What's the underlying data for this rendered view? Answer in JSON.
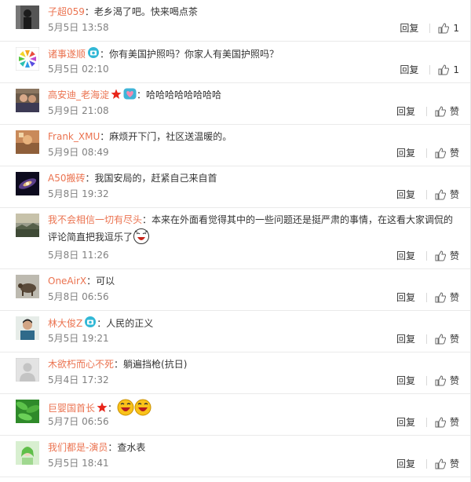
{
  "comments": [
    {
      "user": "子超059",
      "text": "：老乡渴了吧。快来喝点茶",
      "time": "5月5日 13:58",
      "reply": "回复",
      "like": "1",
      "badge": "",
      "avatar": "dark-figure-avatar"
    },
    {
      "user": "诸事遂顺",
      "text": "：你有美国护照吗？你家人有美国护照吗？",
      "time": "5月5日 02:10",
      "reply": "回复",
      "like": "1",
      "badge": "camera",
      "avatar": "flower-logo-avatar"
    },
    {
      "user": "高安迪_老海淀",
      "text": "：哈哈哈哈哈哈哈哈",
      "time": "5月9日 21:08",
      "reply": "回复",
      "like": "赞",
      "badge": "star-heart",
      "avatar": "people-photo-avatar"
    },
    {
      "user": "Frank_XMU",
      "text": "：麻烦开下门，社区送温暖的。",
      "time": "5月9日 08:49",
      "reply": "回复",
      "like": "赞",
      "badge": "",
      "avatar": "warm-photo-avatar"
    },
    {
      "user": "A50搬砖",
      "text": "：我国安局的，赶紧自己来自首",
      "time": "5月8日 19:32",
      "reply": "回复",
      "like": "赞",
      "badge": "",
      "avatar": "galaxy-avatar"
    },
    {
      "user": "我不会相信一切有尽头",
      "text": "：本来在外面看觉得其中的一些问题还是挺严肃的事情，在这看大家调侃的",
      "text2": "评论简直把我逗乐了",
      "time": "5月8日 11:26",
      "reply": "回复",
      "like": "赞",
      "badge": "",
      "avatar": "sunset-landscape-avatar"
    },
    {
      "user": "OneAirX",
      "text": "：可以",
      "time": "5月8日 06:56",
      "reply": "回复",
      "like": "赞",
      "badge": "",
      "avatar": "animal-avatar"
    },
    {
      "user": "林大俊Z",
      "text": "：人民的正义",
      "time": "5月5日 19:21",
      "reply": "回复",
      "like": "赞",
      "badge": "camera",
      "avatar": "portrait-avatar"
    },
    {
      "user": "木欲朽而心不死",
      "text": "：躺遍挡枪(抗日)",
      "time": "5月4日 17:32",
      "reply": "回复",
      "like": "赞",
      "badge": "",
      "avatar": "default-gray-avatar"
    },
    {
      "user": "巨婴国首长",
      "text": "",
      "time": "5月7日 06:56",
      "reply": "回复",
      "like": "赞",
      "badge": "star",
      "avatar": "green-leaves-avatar"
    },
    {
      "user": "我们都是-演员",
      "text": "：查水表",
      "time": "5月5日 18:41",
      "reply": "回复",
      "like": "赞",
      "badge": "",
      "avatar": "green-portrait-avatar"
    }
  ],
  "colors": {
    "username": "#eb7350",
    "meta": "#808080",
    "divider": "#eaeaea"
  }
}
